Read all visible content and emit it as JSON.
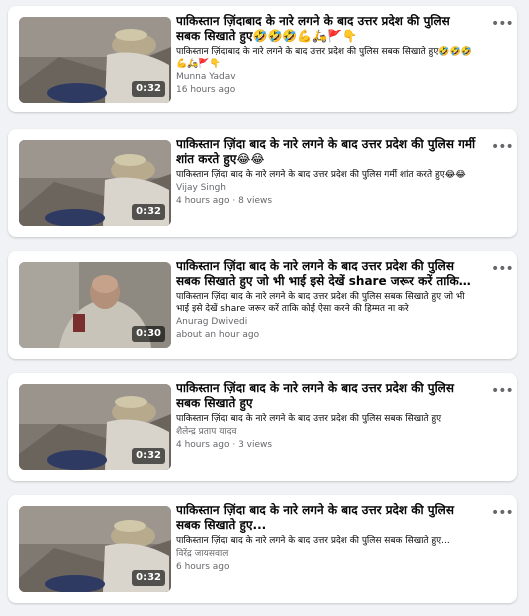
{
  "feed": {
    "cards": [
      {
        "title": "पाकिस्तान ज़िंदाबाद के नारे लगने के बाद उत्तर प्रदेश की पुलिस सबक सिखाते हुए🤣🤣🤣💪🛵🚩👇",
        "description": "पाकिस्तान ज़िंदाबाद के नारे लगने के बाद उत्तर प्रदेश की पुलिस सबक सिखाते हुए🤣🤣🤣💪🛵🚩👇",
        "author": "Munna Yadav",
        "meta": "16 hours ago",
        "duration": "0:32",
        "thumb_icon": "police-video-thumbnail"
      },
      {
        "title": "पाकिस्तान ज़िंदा बाद के नारे लगने के बाद उत्तर प्रदेश की पुलिस गर्मी शांत करते हुए😂😂",
        "description": "पाकिस्तान ज़िंदा बाद के नारे लगने के बाद उत्तर प्रदेश की पुलिस गर्मी शांत करते हुए😂😂",
        "author": "Vijay Singh",
        "meta": "4 hours ago · 8 views",
        "duration": "0:32",
        "thumb_icon": "police-video-thumbnail"
      },
      {
        "title": "पाकिस्तान ज़िंदा बाद के नारे लगने के बाद उत्तर प्रदेश की पुलिस सबक सिखाते हुए जो भी भाई इसे देखें share जरूर करें ताकि ...",
        "description": "पाकिस्तान ज़िंदा बाद के नारे लगने के बाद उत्तर प्रदेश की पुलिस सबक सिखाते हुए जो भी भाई इसे देखें share जरूर करें ताकि कोई ऐसा करने की हिम्मत ना करे",
        "author": "Anurag Dwivedi",
        "meta": "about an hour ago",
        "duration": "0:30",
        "thumb_icon": "police-video-thumbnail"
      },
      {
        "title": "पाकिस्तान ज़िंदा बाद के नारे लगने के बाद उत्तर प्रदेश की पुलिस सबक सिखाते हुए",
        "description": "पाकिस्तान ज़िंदा बाद के नारे लगने के बाद उत्तर प्रदेश की पुलिस सबक सिखाते हुए",
        "author": "शैलेन्द्र प्रताप यादव",
        "meta": "4 hours ago · 3 views",
        "duration": "0:32",
        "thumb_icon": "police-video-thumbnail"
      },
      {
        "title": "पाकिस्तान ज़िंदा बाद के नारे लगने के बाद उत्तर प्रदेश की पुलिस सबक सिखाते हुए...",
        "description": "पाकिस्तान ज़िंदा बाद के नारे लगने के बाद उत्तर प्रदेश की पुलिस सबक सिखाते हुए...",
        "author": "विरेंद्र जायसवाल",
        "meta": "6 hours ago",
        "duration": "0:32",
        "thumb_icon": "police-video-thumbnail"
      }
    ],
    "more_icon": "more-options-icon",
    "more_glyph": "•••"
  }
}
